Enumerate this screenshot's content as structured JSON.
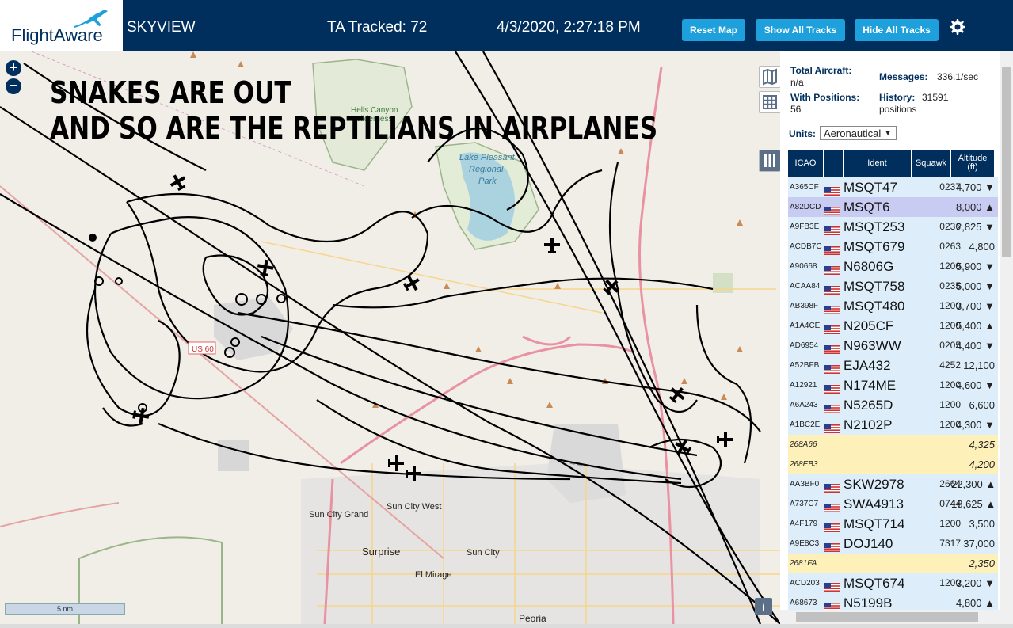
{
  "header": {
    "brand": "FlightAware",
    "site_name": "SKYVIEW",
    "tracked": "TA Tracked: 72",
    "datetime": "4/3/2020, 2:27:18 PM",
    "reset_map": "Reset Map",
    "show_all_tracks": "Show All Tracks",
    "hide_all_tracks": "Hide All Tracks",
    "settings_icon": "gear-icon"
  },
  "overlay": {
    "line1": "SNAKES ARE OUT",
    "line2": "AND SO ARE THE REPTILIANS IN AIRPLANES"
  },
  "map": {
    "zoom_in": "+",
    "zoom_out": "−",
    "scale": "5 nm",
    "info": "i",
    "labels": {
      "hells_canyon": "Hells Canyon",
      "wilderness": "Wilderness",
      "lake_pleasant": "Lake Pleasant",
      "regional": "Regional",
      "park": "Park",
      "us60": "US 60",
      "sun_city_west": "Sun City West",
      "sun_city_grand": "Sun City Grand",
      "surprise": "Surprise",
      "sun_city": "Sun City",
      "el_mirage": "El Mirage",
      "peoria": "Peoria"
    }
  },
  "stats": {
    "total_aircraft_label": "Total Aircraft:",
    "total_aircraft_value": "n/a",
    "with_positions_label": "With Positions:",
    "with_positions_value": "56",
    "messages_label": "Messages:",
    "messages_value": "336.1/sec",
    "history_label": "History:",
    "history_value": "31591",
    "history_unit": "positions",
    "units_label": "Units:",
    "units_value": "Aeronautical"
  },
  "table": {
    "headers": [
      "ICAO",
      "",
      "Ident",
      "Squawk",
      "Altitude",
      "(ft)"
    ],
    "rows": [
      {
        "icao": "A365CF",
        "flag": true,
        "ident": "MSQT47",
        "squawk": "0237",
        "alt": "4,700 ▼",
        "style": "normal"
      },
      {
        "icao": "A82DCD",
        "flag": true,
        "ident": "MSQT6",
        "squawk": "",
        "alt": "8,000 ▲",
        "style": "selected"
      },
      {
        "icao": "A9FB3E",
        "flag": true,
        "ident": "MSQT253",
        "squawk": "0236",
        "alt": "2,825 ▼",
        "style": "normal"
      },
      {
        "icao": "ACDB7C",
        "flag": true,
        "ident": "MSQT679",
        "squawk": "0263",
        "alt": "4,800",
        "style": "normal"
      },
      {
        "icao": "A90668",
        "flag": true,
        "ident": "N6806G",
        "squawk": "1200",
        "alt": "5,900 ▼",
        "style": "normal"
      },
      {
        "icao": "ACAA84",
        "flag": true,
        "ident": "MSQT758",
        "squawk": "0235",
        "alt": "5,000 ▼",
        "style": "normal"
      },
      {
        "icao": "AB398F",
        "flag": true,
        "ident": "MSQT480",
        "squawk": "1200",
        "alt": "3,700 ▼",
        "style": "normal"
      },
      {
        "icao": "A1A4CE",
        "flag": true,
        "ident": "N205CF",
        "squawk": "1200",
        "alt": "5,400 ▲",
        "style": "normal"
      },
      {
        "icao": "AD6954",
        "flag": true,
        "ident": "N963WW",
        "squawk": "0205",
        "alt": "4,400 ▼",
        "style": "normal"
      },
      {
        "icao": "A52BFB",
        "flag": true,
        "ident": "EJA432",
        "squawk": "4252",
        "alt": "12,100",
        "style": "normal"
      },
      {
        "icao": "A12921",
        "flag": true,
        "ident": "N174ME",
        "squawk": "1200",
        "alt": "4,600 ▼",
        "style": "normal"
      },
      {
        "icao": "A6A243",
        "flag": true,
        "ident": "N5265D",
        "squawk": "1200",
        "alt": "6,600",
        "style": "normal"
      },
      {
        "icao": "A1BC2E",
        "flag": true,
        "ident": "N2102P",
        "squawk": "1200",
        "alt": "4,300 ▼",
        "style": "normal"
      },
      {
        "icao": "268A66",
        "flag": false,
        "ident": "",
        "squawk": "",
        "alt": "4,325",
        "style": "mlat"
      },
      {
        "icao": "268EB3",
        "flag": false,
        "ident": "",
        "squawk": "",
        "alt": "4,200",
        "style": "mlat"
      },
      {
        "icao": "AA3BF0",
        "flag": true,
        "ident": "SKW2978",
        "squawk": "2664",
        "alt": "22,300 ▲",
        "style": "normal"
      },
      {
        "icao": "A737C7",
        "flag": true,
        "ident": "SWA4913",
        "squawk": "0744",
        "alt": "18,625 ▲",
        "style": "normal"
      },
      {
        "icao": "A4F179",
        "flag": true,
        "ident": "MSQT714",
        "squawk": "1200",
        "alt": "3,500",
        "style": "normal"
      },
      {
        "icao": "A9E8C3",
        "flag": true,
        "ident": "DOJ140",
        "squawk": "7317",
        "alt": "37,000",
        "style": "normal"
      },
      {
        "icao": "2681FA",
        "flag": false,
        "ident": "",
        "squawk": "",
        "alt": "2,350",
        "style": "mlat"
      },
      {
        "icao": "ACD203",
        "flag": true,
        "ident": "MSQT674",
        "squawk": "1200",
        "alt": "3,200 ▼",
        "style": "normal"
      },
      {
        "icao": "A68673",
        "flag": true,
        "ident": "N5199B",
        "squawk": "",
        "alt": "4,800 ▲",
        "style": "normal"
      }
    ]
  },
  "colors": {
    "header_bg": "#002f5d",
    "button_bg": "#1ea0dc",
    "row_normal": "#ddeefa",
    "row_selected": "#c8ccf2",
    "row_mlat": "#fdf0b8"
  }
}
